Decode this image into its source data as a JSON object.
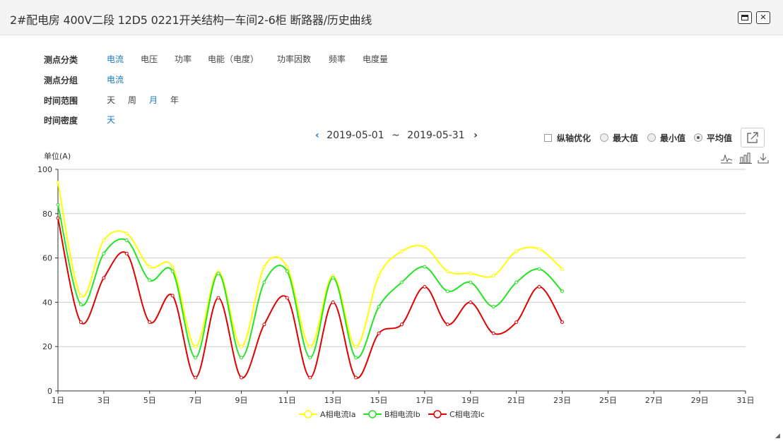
{
  "window": {
    "title": "2#配电房 400V二段 12D5 0221开关结构一车间2-6柜 断路器/历史曲线"
  },
  "filters": {
    "category": {
      "label": "测点分类",
      "options": [
        "电流",
        "电压",
        "功率",
        "电能（电度）",
        "功率因数",
        "频率",
        "电度量"
      ],
      "selected": "电流"
    },
    "group": {
      "label": "测点分组",
      "options": [
        "电流"
      ],
      "selected": "电流"
    },
    "range": {
      "label": "时间范围",
      "options": [
        "天",
        "周",
        "月",
        "年"
      ],
      "selected": "月"
    },
    "density": {
      "label": "时间密度",
      "options": [
        "天"
      ],
      "selected": "天"
    }
  },
  "daterange": {
    "prev": "‹",
    "start": "2019-05-01",
    "sep": "~",
    "end": "2019-05-31",
    "next": "›"
  },
  "options": {
    "axis_opt": "纵轴优化",
    "max": "最大值",
    "min": "最小值",
    "avg": "平均值",
    "selected": "平均值"
  },
  "toolbox": [
    "line-chart-icon",
    "bar-chart-icon",
    "download-icon"
  ],
  "colors": {
    "accent": "#1a7bc1",
    "seriesA": "#ffff00",
    "seriesB": "#22e522",
    "seriesC": "#e00000"
  },
  "chart_data": {
    "type": "line",
    "unit_label": "单位(A)",
    "ylim": [
      0,
      100
    ],
    "yticks": [
      "0",
      "20",
      "40",
      "60",
      "80",
      "100"
    ],
    "x": [
      1,
      2,
      3,
      4,
      5,
      6,
      7,
      8,
      9,
      10,
      11,
      12,
      13,
      14,
      15,
      16,
      17,
      18,
      19,
      20,
      21,
      22,
      23
    ],
    "xticks": [
      "1日",
      "3日",
      "5日",
      "7日",
      "9日",
      "11日",
      "13日",
      "15日",
      "17日",
      "19日",
      "21日",
      "23日",
      "25日",
      "27日",
      "29日",
      "31日"
    ],
    "xlim": [
      1,
      31
    ],
    "grid": true,
    "legend_position": "bottom",
    "series": [
      {
        "name": "A相电流Ia",
        "values": [
          94,
          43,
          68,
          71,
          56,
          56,
          20,
          54,
          20,
          56,
          56,
          20,
          52,
          20,
          52,
          63,
          65,
          54,
          53,
          52,
          63,
          64,
          55
        ]
      },
      {
        "name": "B相电流Ib",
        "values": [
          84,
          39,
          62,
          68,
          50,
          54,
          15,
          53,
          15,
          49,
          54,
          15,
          51,
          15,
          38,
          49,
          56,
          45,
          49,
          38,
          49,
          55,
          45
        ]
      },
      {
        "name": "C相电流Ic",
        "values": [
          78,
          31,
          51,
          62,
          31,
          43,
          6,
          42,
          6,
          30,
          42,
          6,
          40,
          6,
          26,
          30,
          47,
          30,
          40,
          26,
          31,
          47,
          31
        ]
      }
    ]
  }
}
